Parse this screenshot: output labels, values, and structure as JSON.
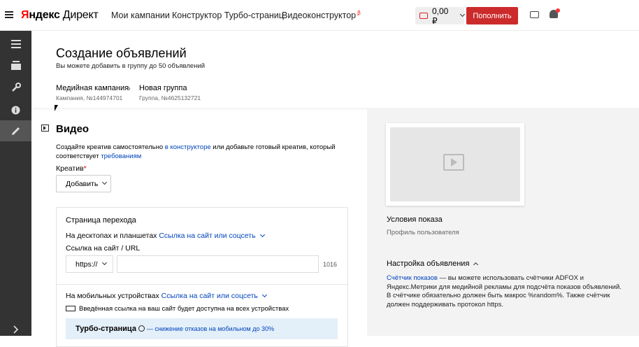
{
  "topbar": {
    "logo_yandex_first": "Я",
    "logo_yandex_rest": "ндекс",
    "logo_direct": "Директ",
    "nav": [
      "Мои кампании",
      "Конструктор Турбо-страниц",
      "Видеоконструктор"
    ],
    "nav_badge": "β",
    "balance": "0,00 ₽",
    "topup_label": "Пополнить"
  },
  "sidebar": {
    "items": [
      "layers-icon",
      "stack-icon",
      "wrench-icon",
      "info-icon",
      "pencil-icon"
    ],
    "expand": "chevron-right-icon"
  },
  "header": {
    "title": "Создание объявлений",
    "subtitle": "Вы можете добавить в группу до 50 объявлений",
    "breadcrumbs": [
      {
        "name": "Медийная кампания",
        "sub": "Кампания, №144974701"
      },
      {
        "name": "Новая группа",
        "sub": "Группа, №4625132721"
      }
    ]
  },
  "video": {
    "title": "Видео",
    "intro_1": "Создайте креатив самостоятельно ",
    "intro_link1": "в конструкторе",
    "intro_2": " или добавьте готовый креатив, который соответствует ",
    "intro_link2": "требованиям",
    "creative_label": "Креатив",
    "required_mark": "*",
    "add_label": "Добавить"
  },
  "landing": {
    "title": "Страница перехода",
    "desktop_label": "На десктопах и планшетах",
    "desktop_select": "Ссылка на сайт или соцсеть",
    "url_label": "Ссылка на сайт / URL",
    "protocol": "https://",
    "url_value": "",
    "counter": "1016",
    "mobile_label": "На мобильных устройствах",
    "mobile_select": "Ссылка на сайт или соцсеть",
    "devices_note": "Введённая ссылка на ваш сайт будет доступна на всех устройствах",
    "turbo_title": "Турбо-страница",
    "turbo_note": "— снижение отказов на мобильном до 30%"
  },
  "right": {
    "conditions_title": "Условия показа",
    "conditions_sub": "Профиль пользователя",
    "settings_title": "Настройка объявления",
    "settings_link": "Счётчик показов",
    "settings_text": " — вы можете использовать счётчики ADFOX и Яндекс.Метрики для медийной рекламы для подсчёта показов объявлений. В счётчике обязательно должен быть макрос %random%. Также счётчик должен поддерживать протокол https."
  }
}
